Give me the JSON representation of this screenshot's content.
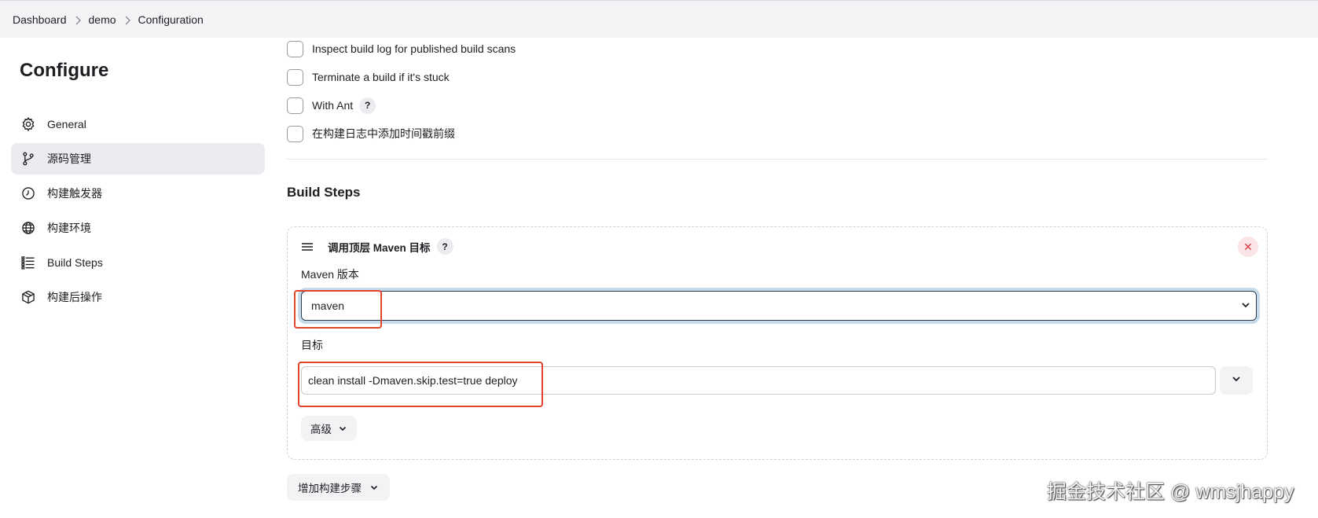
{
  "breadcrumb": {
    "items": [
      "Dashboard",
      "demo",
      "Configuration"
    ]
  },
  "sidebar": {
    "title": "Configure",
    "items": [
      {
        "label": "General",
        "icon": "gear-icon",
        "active": false
      },
      {
        "label": "源码管理",
        "icon": "branch-icon",
        "active": true
      },
      {
        "label": "构建触发器",
        "icon": "timer-icon",
        "active": false
      },
      {
        "label": "构建环境",
        "icon": "globe-icon",
        "active": false
      },
      {
        "label": "Build Steps",
        "icon": "list-icon",
        "active": false
      },
      {
        "label": "构建后操作",
        "icon": "package-icon",
        "active": false
      }
    ]
  },
  "build_env": {
    "options": [
      {
        "label": "Inspect build log for published build scans",
        "checked": false,
        "help": false
      },
      {
        "label": "Terminate a build if it's stuck",
        "checked": false,
        "help": false
      },
      {
        "label": "With Ant",
        "checked": false,
        "help": true
      },
      {
        "label": "在构建日志中添加时间戳前缀",
        "checked": false,
        "help": false
      }
    ]
  },
  "build_steps": {
    "title": "Build Steps",
    "step": {
      "title": "调用顶层 Maven 目标",
      "help_label": "?",
      "delete_label": "✕",
      "maven_version_label": "Maven 版本",
      "maven_version_value": "maven",
      "goals_label": "目标",
      "goals_value": "clean install -Dmaven.skip.test=true deploy",
      "advanced_label": "高级"
    },
    "add_step_label": "增加构建步骤"
  },
  "help_label": "?",
  "annotation_color": "#e0452c",
  "watermark": "掘金技术社区 @ wmsjhappy"
}
